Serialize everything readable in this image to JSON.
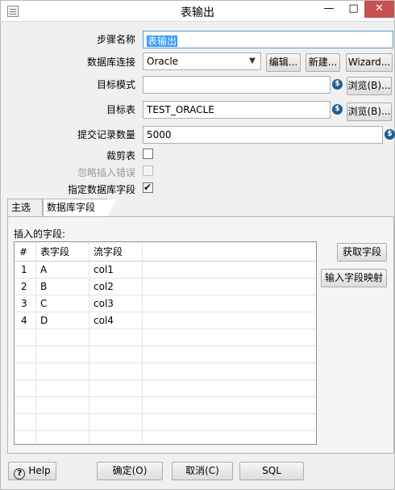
{
  "window": {
    "title": "表输出",
    "minimize": "—",
    "maximize": "□",
    "close": "✕"
  },
  "form": {
    "step_name_label": "步骤名称",
    "step_name_value": "表输出",
    "db_conn_label": "数据库连接",
    "db_conn_value": "Oracle",
    "edit_btn": "编辑...",
    "new_btn": "新建...",
    "wizard_btn": "Wizard...",
    "target_schema_label": "目标模式",
    "target_schema_value": "",
    "browse_schema_btn": "浏览(B)...",
    "target_table_label": "目标表",
    "target_table_value": "TEST_ORACLE",
    "browse_table_btn": "浏览(B)...",
    "commit_size_label": "提交记录数量",
    "commit_size_value": "5000",
    "truncate_label": "裁剪表",
    "truncate_checked": false,
    "ignore_errors_label": "忽略插入错误",
    "ignore_errors_checked": false,
    "specify_fields_label": "指定数据库字段",
    "specify_fields_checked": true,
    "variable_icon": "$"
  },
  "tabs": [
    {
      "label": "主选项",
      "active": false
    },
    {
      "label": "数据库字段",
      "active": true
    }
  ],
  "fields_tab": {
    "insert_fields_label": "插入的字段:",
    "get_fields_btn": "获取字段",
    "input_mapping_btn": "输入字段映射",
    "columns": [
      "#",
      "表字段",
      "流字段"
    ],
    "rows": [
      {
        "num": "1",
        "table_field": "A",
        "stream_field": "col1"
      },
      {
        "num": "2",
        "table_field": "B",
        "stream_field": "col2"
      },
      {
        "num": "3",
        "table_field": "C",
        "stream_field": "col3"
      },
      {
        "num": "4",
        "table_field": "D",
        "stream_field": "col4"
      }
    ]
  },
  "footer": {
    "help_btn": "Help",
    "ok_btn": "确定(O)",
    "cancel_btn": "取消(C)",
    "sql_btn": "SQL"
  }
}
